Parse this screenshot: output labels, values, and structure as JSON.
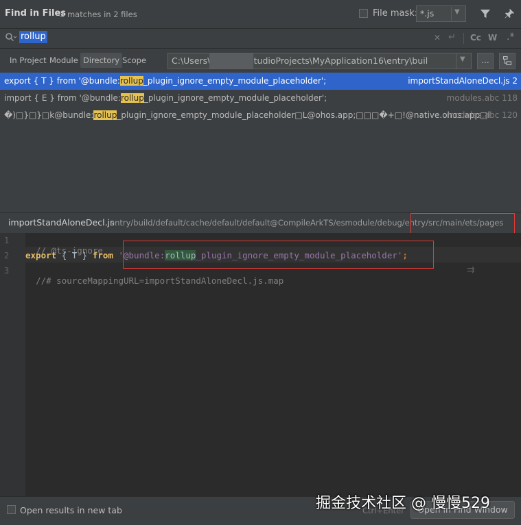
{
  "header": {
    "title": "Find in Files",
    "matches": "3 matches in 2 files",
    "file_mask_label": "File mask:",
    "file_mask_value": "*.js"
  },
  "search": {
    "query": "rollup",
    "case_label": "Cc",
    "word_label": "W",
    "regex_label": ".*"
  },
  "scope": {
    "tabs": [
      "In Project",
      "Module",
      "Directory",
      "Scope"
    ],
    "active_tab": "Directory",
    "directory_value": "C:\\Users\\              \\DevEcoStudioProjects\\MyApplication16\\entry\\buil",
    "browse_label": "..."
  },
  "results": [
    {
      "before": "export { T } from '@bundle:",
      "match": "rollup",
      "after": "_plugin_ignore_empty_module_placeholder';",
      "file": "importStandAloneDecl.js 2",
      "selected": true
    },
    {
      "before": "import { E } from '@bundle:",
      "match": "rollup",
      "after": "_plugin_ignore_empty_module_placeholder';",
      "file": "modules.abc 118",
      "selected": false
    },
    {
      "before": "�)□}□}□k@bundle:",
      "match": "rollup",
      "after": "_plugin_ignore_empty_module_placeholder□L@ohos.app;□□□�+□!@native.ohos.app□l",
      "file": "modules.abc 120",
      "selected": false
    }
  ],
  "preview": {
    "file_name": "importStandAloneDecl.js",
    "path": "entry/build/default/cache/default/default@CompileArkTS/esmodule/debug/entry/src/main/ets/pages",
    "lines": {
      "l1": {
        "no": "1",
        "text": "// @ts-ignore"
      },
      "l2": {
        "no": "2",
        "kw_export": "export",
        "brace": " { T } ",
        "kw_from": "from",
        "space": " ",
        "str_start": "'@bundle:",
        "str_match": "rollup",
        "str_rest": "_plugin_ignore_empty_module_placeholder'",
        "semi": ";"
      },
      "l3": {
        "no": "3",
        "text": "//# sourceMappingURL=importStandAloneDecl.js.map"
      }
    }
  },
  "footer": {
    "open_new_tab_label": "Open results in new tab",
    "shortcut": "Ctrl+Enter",
    "open_button_label": "Open in Find Window"
  },
  "watermark": "掘金技术社区 @ 慢慢529",
  "colors": {
    "selection": "#2f65ca",
    "match_highlight": "#e6c250",
    "annotation_red": "#e53935",
    "background": "#3c3f41",
    "editor_bg": "#2b2b2b"
  }
}
